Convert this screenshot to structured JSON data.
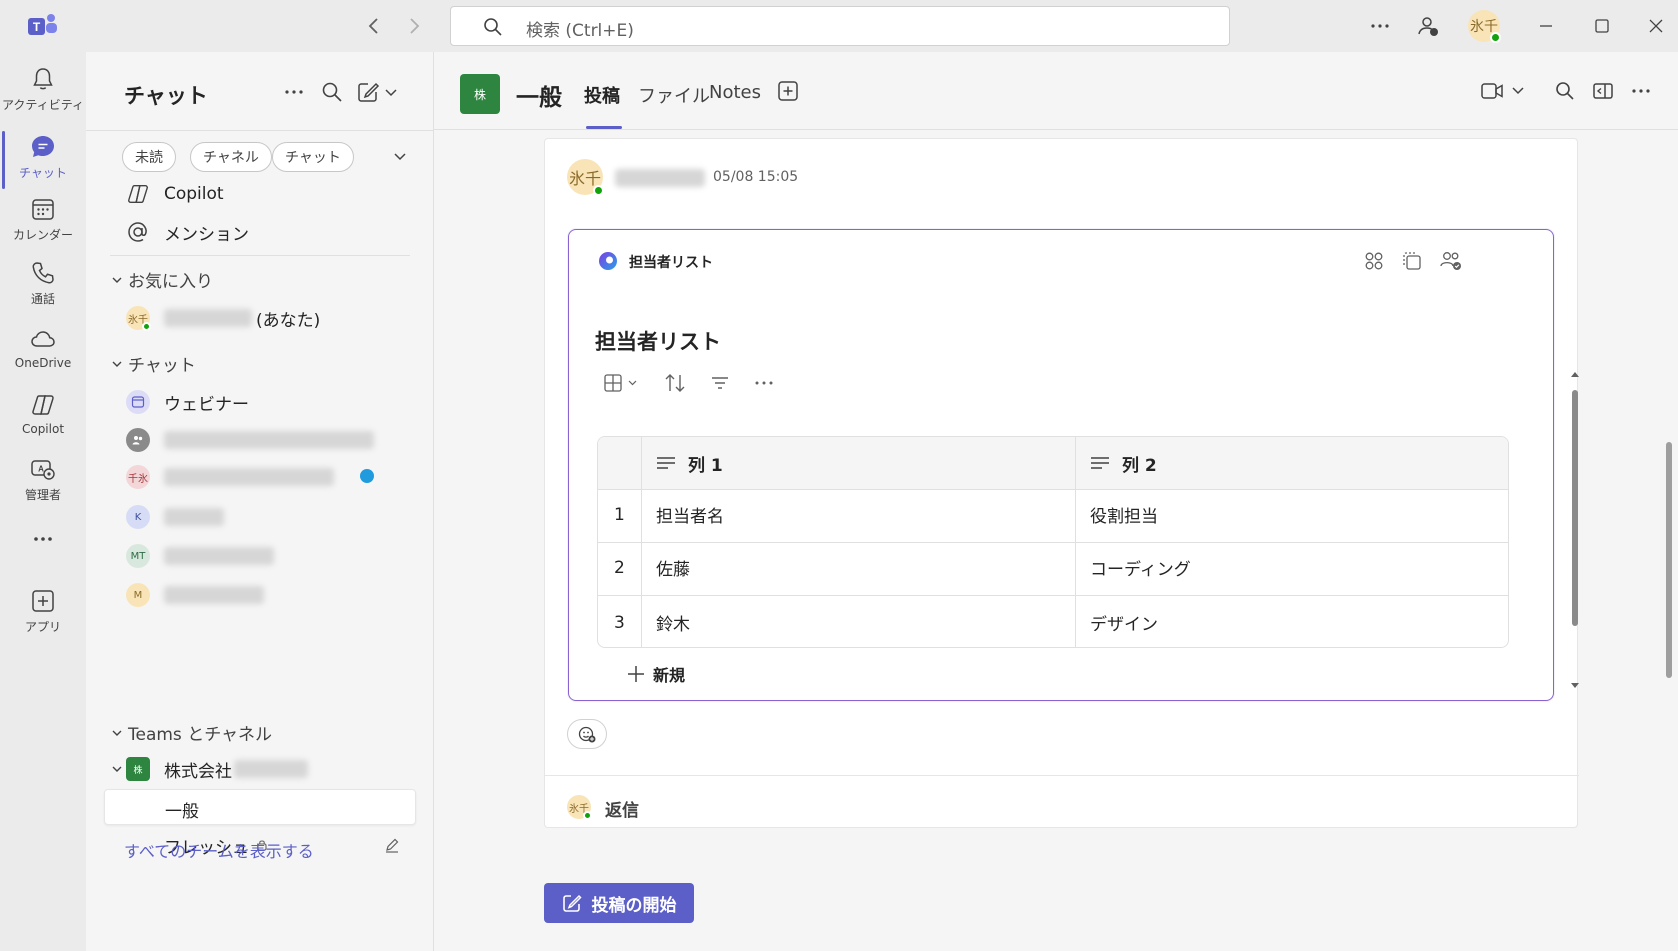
{
  "titlebar": {
    "search_placeholder": "検索 (Ctrl+E)",
    "user_initials": "氷千"
  },
  "rail": {
    "items": [
      {
        "label": "アクティビティ",
        "icon": "bell-icon"
      },
      {
        "label": "チャット",
        "icon": "chat-icon",
        "active": true
      },
      {
        "label": "カレンダー",
        "icon": "calendar-icon"
      },
      {
        "label": "通話",
        "icon": "phone-icon"
      },
      {
        "label": "OneDrive",
        "icon": "cloud-icon"
      },
      {
        "label": "Copilot",
        "icon": "copilot-icon"
      },
      {
        "label": "管理者",
        "icon": "admin-icon"
      },
      {
        "label": "アプリ",
        "icon": "add-app-icon"
      }
    ],
    "accent": "#5b5fc7"
  },
  "sidepanel": {
    "title": "チャット",
    "filters": [
      "未読",
      "チャネル",
      "チャット"
    ],
    "quick": [
      {
        "label": "Copilot",
        "icon": "copilot-icon"
      },
      {
        "label": "メンション",
        "icon": "at-icon"
      }
    ],
    "favorites": {
      "header": "お気に入り",
      "self_initials": "氷千",
      "self_suffix": "(あなた)"
    },
    "chats": {
      "header": "チャット",
      "items": [
        {
          "label": "ウェビナー",
          "initials": ""
        },
        {
          "label": "",
          "initials": ""
        },
        {
          "label": "",
          "initials": "千氷"
        },
        {
          "label": "",
          "initials": "K"
        },
        {
          "label": "",
          "initials": "MT"
        },
        {
          "label": "",
          "initials": "M"
        }
      ]
    },
    "teams": {
      "header": "Teams とチャネル",
      "team_name": "株式会社",
      "team_initial": "株",
      "channels": [
        "一般",
        "フレッシュ"
      ],
      "show_all": "すべてのチームを表示する"
    }
  },
  "channel": {
    "team_initial": "株",
    "name": "一般",
    "tabs": [
      "投稿",
      "ファイル",
      "Notes"
    ],
    "active_tab": "投稿",
    "team_color": "#2e8540"
  },
  "post": {
    "author_initials": "氷千",
    "timestamp": "05/08 15:05",
    "card": {
      "app_name": "担当者リスト",
      "list_title": "担当者リスト",
      "columns": [
        "列 1",
        "列 2"
      ],
      "rows": [
        {
          "num": "1",
          "c1": "担当者名",
          "c2": "役割担当"
        },
        {
          "num": "2",
          "c1": "佐藤",
          "c2": "コーディング"
        },
        {
          "num": "3",
          "c1": "鈴木",
          "c2": "デザイン"
        }
      ],
      "new_label": "新規"
    },
    "reply_initials": "氷千",
    "reply_label": "返信"
  },
  "compose": {
    "start_post_label": "投稿の開始"
  }
}
